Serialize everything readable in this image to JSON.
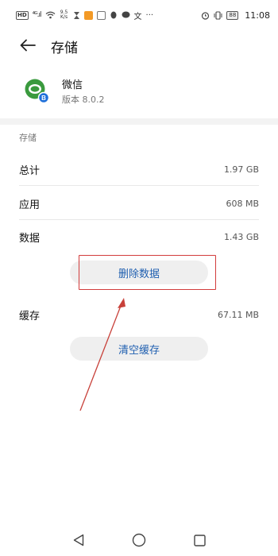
{
  "status_bar": {
    "hd": "HD",
    "signal": "⁴ᴳ.ıl",
    "speed_top": "9.5",
    "speed_bottom": "K/s",
    "battery": "88",
    "time": "11:08"
  },
  "header": {
    "title": "存储"
  },
  "app": {
    "name": "微信",
    "version": "版本 8.0.2",
    "badge": "B"
  },
  "storage": {
    "section_label": "存储",
    "rows": [
      {
        "label": "总计",
        "value": "1.97 GB"
      },
      {
        "label": "应用",
        "value": "608 MB"
      },
      {
        "label": "数据",
        "value": "1.43 GB"
      }
    ],
    "delete_data_label": "删除数据",
    "cache_label": "缓存",
    "cache_value": "67.11 MB",
    "clear_cache_label": "清空缓存"
  },
  "colors": {
    "accent": "#1f5fb0",
    "annotation": "#d23c3c",
    "button_bg": "#efefef"
  },
  "icons": {
    "back": "arrow-left-icon",
    "nav_back": "triangle-back-icon",
    "nav_home": "circle-home-icon",
    "nav_recent": "square-recent-icon"
  }
}
